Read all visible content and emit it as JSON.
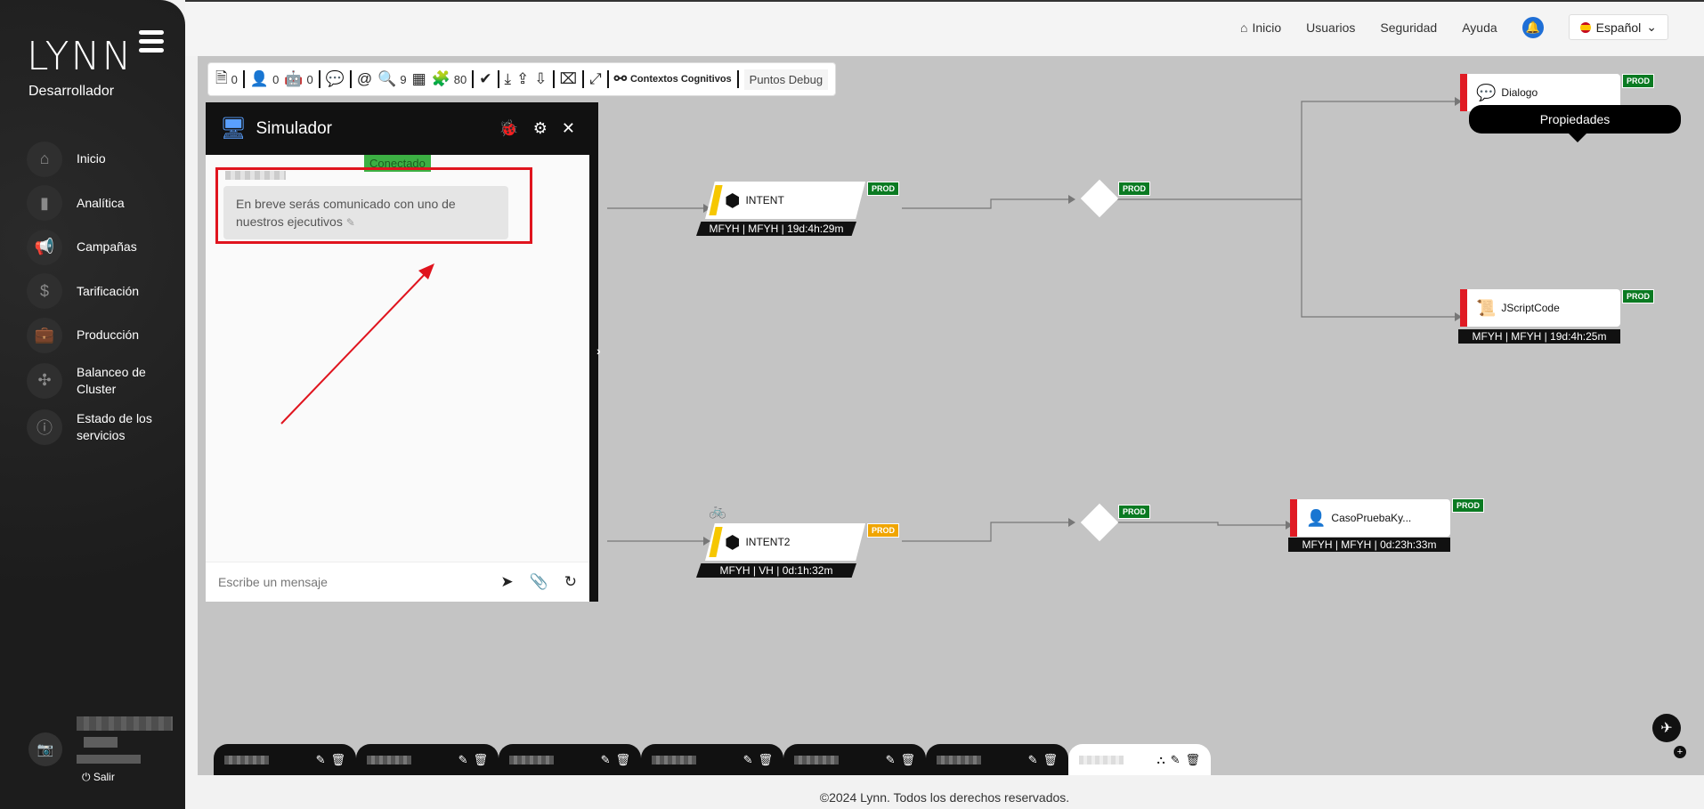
{
  "sidebar": {
    "logo": "LYNN",
    "role": "Desarrollador",
    "items": [
      {
        "label": "Inicio",
        "icon": "home-icon",
        "glyph": "⌂"
      },
      {
        "label": "Analítica",
        "icon": "bar-chart-icon",
        "glyph": "▮"
      },
      {
        "label": "Campañas",
        "icon": "megaphone-icon",
        "glyph": "📢"
      },
      {
        "label": "Tarificación",
        "icon": "dollar-icon",
        "glyph": "$"
      },
      {
        "label": "Producción",
        "icon": "briefcase-icon",
        "glyph": "💼"
      },
      {
        "label": "Balanceo de Cluster",
        "icon": "cluster-icon",
        "glyph": "✣"
      },
      {
        "label": "Estado de los servicios",
        "icon": "info-icon",
        "glyph": "ⓘ"
      }
    ],
    "logout": "Salir"
  },
  "topnav": {
    "home": "Inicio",
    "users": "Usuarios",
    "security": "Seguridad",
    "help": "Ayuda",
    "language": "Español"
  },
  "toolbar": {
    "items": [
      {
        "icon": "document-icon",
        "glyph": "🗎",
        "count": "0"
      },
      {
        "icon": "agent-icon",
        "glyph": "👤",
        "count": "0"
      },
      {
        "icon": "robot-icon",
        "glyph": "🤖",
        "count": "0"
      },
      {
        "icon": "chat-icon",
        "glyph": "💬",
        "count": ""
      },
      {
        "icon": "at-icon",
        "glyph": "@",
        "count": ""
      },
      {
        "icon": "search-icon",
        "glyph": "🔍",
        "count": "9"
      },
      {
        "icon": "images-icon",
        "glyph": "▦",
        "count": ""
      },
      {
        "icon": "puzzle-icon",
        "glyph": "🧩",
        "count": "80"
      },
      {
        "icon": "check-icon",
        "glyph": "✔",
        "count": ""
      },
      {
        "icon": "import-icon",
        "glyph": "⤓",
        "count": ""
      },
      {
        "icon": "upload-icon",
        "glyph": "⇪",
        "count": ""
      },
      {
        "icon": "download-file-icon",
        "glyph": "⇩",
        "count": ""
      },
      {
        "icon": "clean-icon",
        "glyph": "⌧",
        "count": ""
      },
      {
        "icon": "link-icon",
        "glyph": "⤢",
        "count": ""
      }
    ],
    "contexts": "Contextos Cognitivos",
    "debug": "Puntos Debug"
  },
  "simulator": {
    "title": "Simulador",
    "status": "Conectado",
    "message": "En breve serás comunicado con uno de nuestros ejecutivos",
    "input_placeholder": "Escribe un mensaje"
  },
  "flow": {
    "intent1": {
      "name": "INTENT",
      "meta": "MFYH | MFYH | 19d:4h:29m",
      "badge": "PROD"
    },
    "intent2": {
      "name": "INTENT2",
      "meta": "MFYH | VH | 0d:1h:32m",
      "badge": "PROD"
    },
    "diamond1_badge": "PROD",
    "diamond2_badge": "PROD",
    "dialogo": {
      "name": "Dialogo",
      "badge": "PROD"
    },
    "tooltip": "Propiedades",
    "jscript": {
      "name": "JScriptCode",
      "meta": "MFYH | MFYH | 19d:4h:25m",
      "badge": "PROD"
    },
    "caso": {
      "name": "CasoPruebaKy...",
      "meta": "MFYH | MFYH | 0d:23h:33m",
      "badge": "PROD"
    }
  },
  "footer": "©2024 Lynn. Todos los derechos reservados.",
  "colors": {
    "prod": "#0a7a22",
    "prod_warn": "#f0a500",
    "highlight": "#e0141e",
    "connected": "#3cb043"
  }
}
